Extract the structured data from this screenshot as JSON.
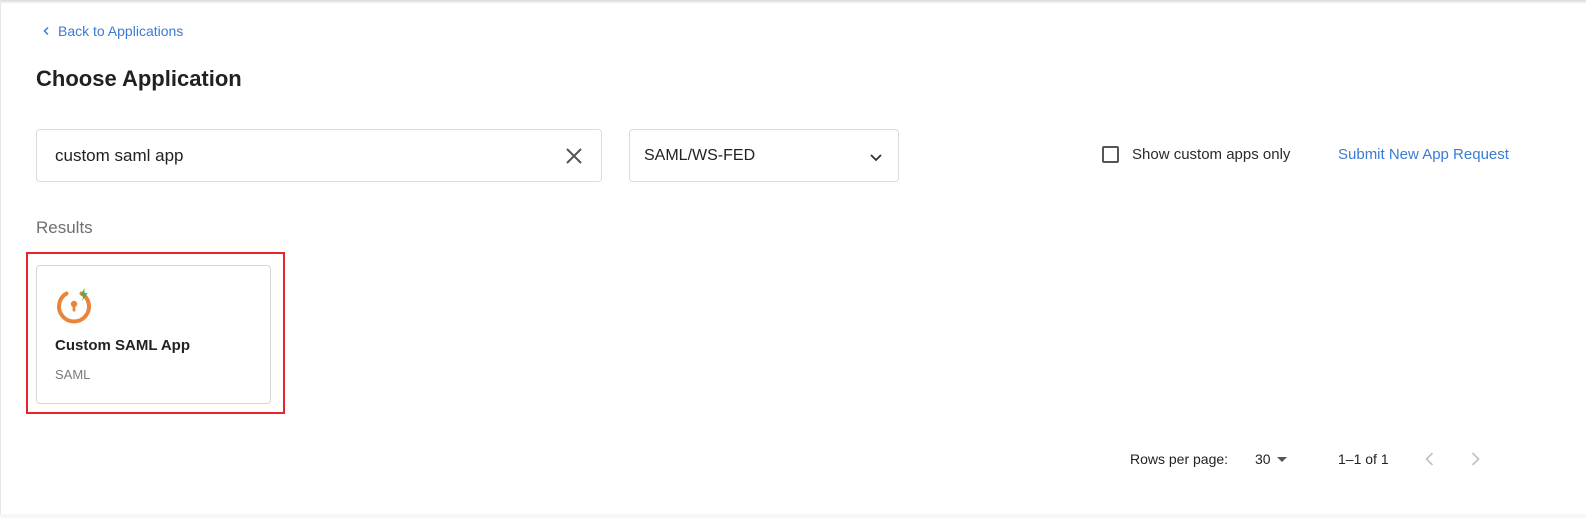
{
  "nav": {
    "back_label": "Back to Applications"
  },
  "page": {
    "title": "Choose Application"
  },
  "search": {
    "value": "custom saml app"
  },
  "filter": {
    "selected": "SAML/WS-FED"
  },
  "custom_apps_toggle": {
    "label": "Show custom apps only",
    "checked": false
  },
  "submit_request": {
    "label": "Submit New App Request"
  },
  "results": {
    "label": "Results",
    "items": [
      {
        "name": "Custom SAML App",
        "type": "SAML",
        "icon": "custom-app-logo-icon"
      }
    ]
  },
  "pagination": {
    "rows_label": "Rows per page:",
    "rows_value": "30",
    "range": "1–1 of 1"
  },
  "colors": {
    "link": "#3a7bd5",
    "highlight": "#e5242b",
    "icon_orange": "#e8853a",
    "icon_green": "#4caf50"
  }
}
